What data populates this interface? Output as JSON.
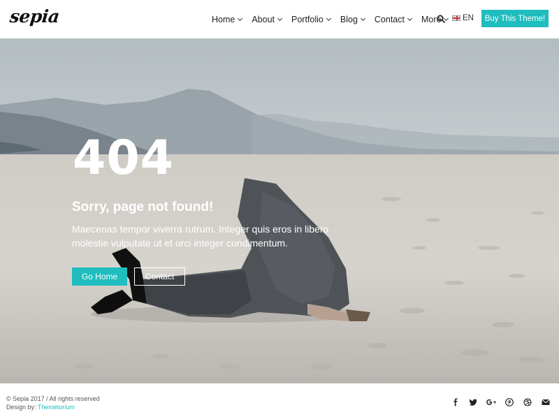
{
  "header": {
    "logo": "sepia",
    "nav": [
      {
        "label": "Home"
      },
      {
        "label": "About"
      },
      {
        "label": "Portfolio"
      },
      {
        "label": "Blog"
      },
      {
        "label": "Contact"
      },
      {
        "label": "More"
      }
    ],
    "language": "EN",
    "buy_button": "Buy This Theme!"
  },
  "hero": {
    "code": "404",
    "headline": "Sorry, page not found!",
    "description": "Maecenas tempor viverra rutrum. Integer quis eros in libero molestie vulputate ut et orci integer condimentum.",
    "home_button": "Go Home",
    "contact_button": "Contact"
  },
  "footer": {
    "copyright": "© Sepia 2017  /  All rights reserved",
    "design_by_label": "Design by:",
    "design_by_link": "Themetorium",
    "social": [
      "facebook-icon",
      "twitter-icon",
      "google-plus-icon",
      "pinterest-icon",
      "dribbble-icon",
      "email-icon"
    ]
  },
  "colors": {
    "accent": "#1fbdbd",
    "text": "#222222"
  }
}
